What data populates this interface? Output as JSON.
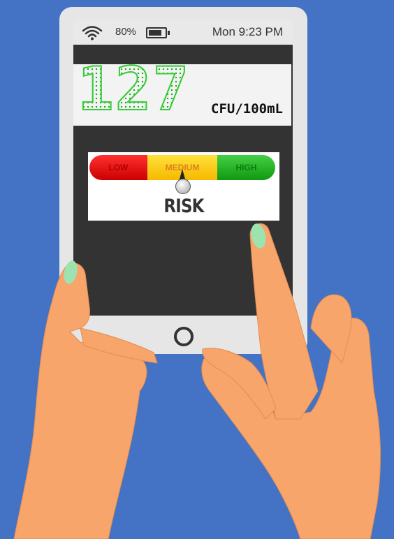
{
  "status_bar": {
    "battery_percent": "80%",
    "battery_level": 0.8,
    "clock": "Mon 9:23 PM"
  },
  "reading": {
    "value": "127",
    "unit": "CFU/100mL"
  },
  "gauge": {
    "segments": [
      {
        "label": "LOW",
        "color": "#e01010"
      },
      {
        "label": "MEDIUM",
        "color": "#ffd21a"
      },
      {
        "label": "HIGH",
        "color": "#2fbf2f"
      }
    ],
    "needle_position": 0.5,
    "caption": "RISK"
  },
  "colors": {
    "background": "#4472c4",
    "skin": "#f7a56a",
    "nail": "#9de3b0"
  },
  "icons": [
    "wifi-icon",
    "battery-icon",
    "home-button"
  ]
}
